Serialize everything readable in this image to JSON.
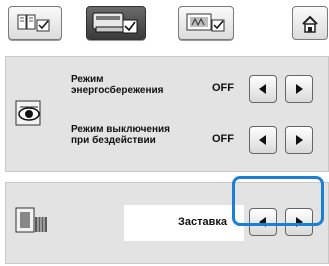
{
  "toolbar": {
    "tabs": [
      {
        "name": "general-settings-tab",
        "icon": "book-check-icon",
        "selected": false
      },
      {
        "name": "sewing-settings-tab",
        "icon": "sewing-machine-check-icon",
        "selected": true
      },
      {
        "name": "embroidery-settings-tab",
        "icon": "embroidery-check-icon",
        "selected": false
      }
    ],
    "home_icon": "home-icon"
  },
  "power_panel": {
    "icon": "eco-mode-icon",
    "eco_mode": {
      "label": "Режим\nэнергосбережения",
      "value": "OFF"
    },
    "shutdown_mode": {
      "label": "Режим выключения\nпри бездействии",
      "value": "OFF"
    }
  },
  "screensaver_panel": {
    "icon": "screensaver-icon",
    "value": "Заставка"
  },
  "colors": {
    "highlight": "#1c7fd6",
    "panel": "#e3e3e3"
  }
}
